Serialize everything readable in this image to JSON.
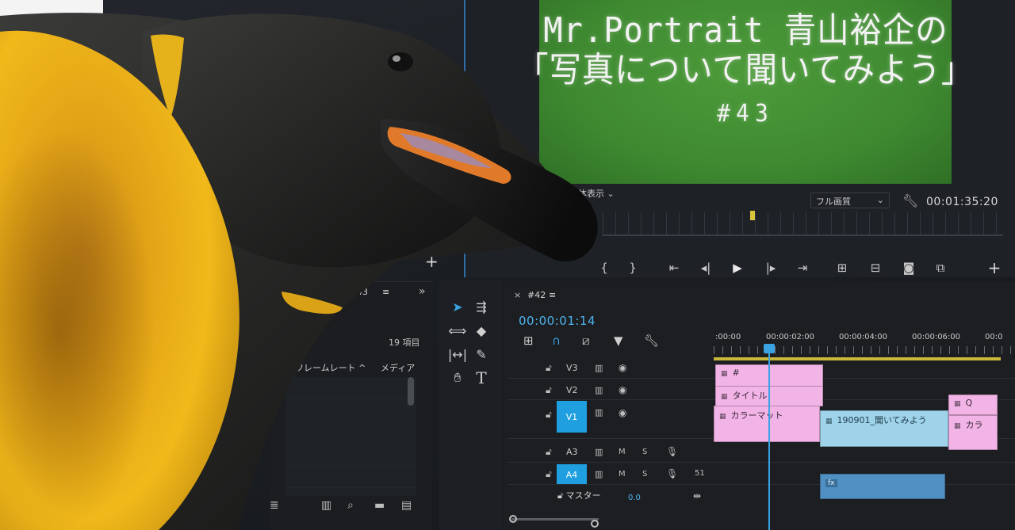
{
  "monitor": {
    "title_lines": [
      "Mr.Portrait 青山裕企の",
      "「写真について聞いてみよう」",
      "#43"
    ],
    "fit_label": "全体表示",
    "quality_label": "フル画質",
    "timecode": "00:01:35:20"
  },
  "project": {
    "tab_label": "43",
    "item_count": "19 項目",
    "col_framerate": "フレームレート",
    "col_media": "メディア"
  },
  "timeline": {
    "sequence_tab": "#42",
    "timecode": "00:00:01:14",
    "ruler_labels": [
      ":00:00",
      "00:00:02:00",
      "00:00:04:00",
      "00:00:06:00",
      "00:0"
    ],
    "tracks": {
      "v3": "V3",
      "v2": "V2",
      "v1": "V1",
      "a3": "A3",
      "a4": "A4",
      "master": "マスター",
      "master_value": "0.0",
      "mute_label": "M",
      "solo_label": "S",
      "a4_channel": "51"
    },
    "clips": {
      "v3_clip": "#",
      "v2_clip": "タイトル",
      "v1_colormatte": "カラーマット",
      "v1_video": "190901_聞いてみよう",
      "v2_right": "Q",
      "v1_right": "カラ",
      "fx_label": "fx"
    }
  },
  "colors": {
    "accent": "#3aa3e3",
    "title_clip": "#f2b3e6",
    "video_clip": "#9fd3ea",
    "audio_clip": "#4f8fc2",
    "green_screen": "#3f8a31"
  },
  "icons": [
    "wrench-icon",
    "play-icon",
    "step-back-icon",
    "step-forward-icon",
    "camera-icon",
    "lock-icon",
    "eye-icon",
    "mic-icon",
    "selection-tool-icon",
    "type-tool-icon",
    "hand-tool-icon",
    "razor-tool-icon",
    "pen-tool-icon",
    "magnet-icon",
    "marker-icon",
    "search-icon",
    "folder-icon"
  ]
}
